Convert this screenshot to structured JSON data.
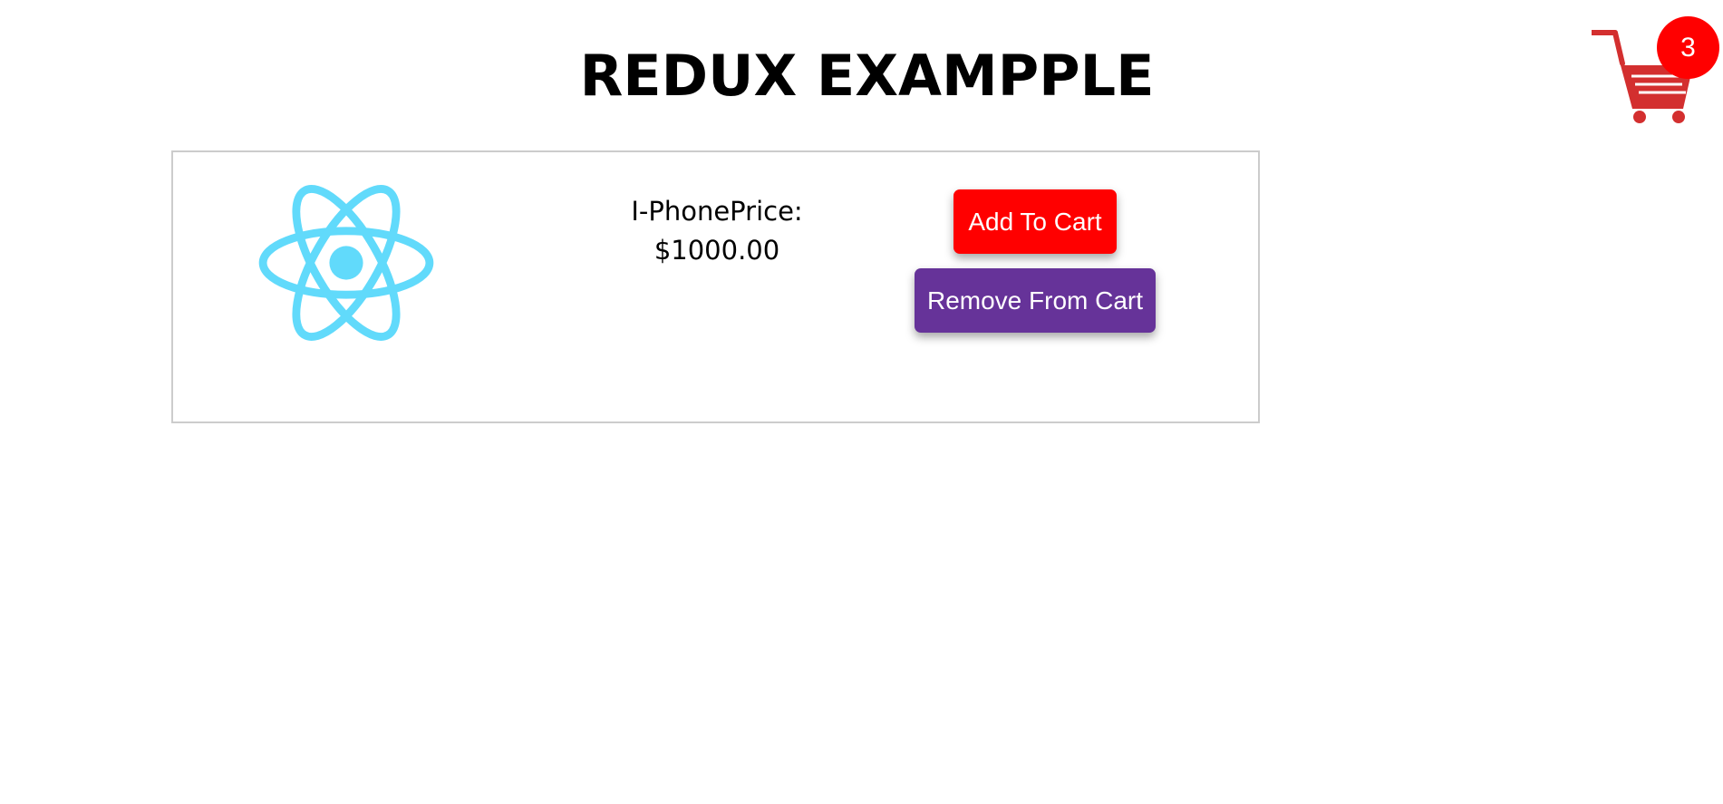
{
  "header": {
    "title": "REDUX EXAMPPLE"
  },
  "cart": {
    "icon": "shopping-cart-icon",
    "count": "3",
    "icon_color": "#d32f2f",
    "badge_color": "#ff0000"
  },
  "product": {
    "image_icon": "react-logo-icon",
    "name_price": "I-PhonePrice:",
    "price": "$1000.00",
    "add_label": "Add To Cart",
    "remove_label": "Remove From Cart",
    "add_color": "#ff0000",
    "remove_color": "#663399",
    "logo_color": "#61dafb"
  }
}
